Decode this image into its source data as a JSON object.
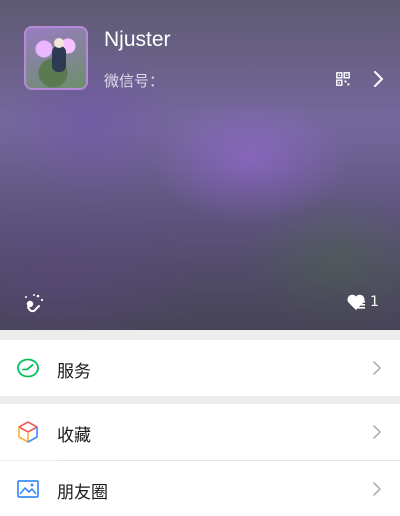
{
  "profile": {
    "name": "Njuster",
    "wechat_id_label": "微信号：",
    "likes_count": "1"
  },
  "menu": {
    "services_label": "服务",
    "favorites_label": "收藏",
    "moments_label": "朋友圈"
  },
  "colors": {
    "services_icon": "#07c160",
    "hero_tint": "#7c6ea6"
  },
  "icons": {
    "qr": "qr-code-icon",
    "profile_arrow": "chevron-right-icon",
    "status": "status-icon",
    "likes": "heart-icon",
    "services": "services-icon",
    "favorites": "cube-icon",
    "moments": "image-icon"
  }
}
